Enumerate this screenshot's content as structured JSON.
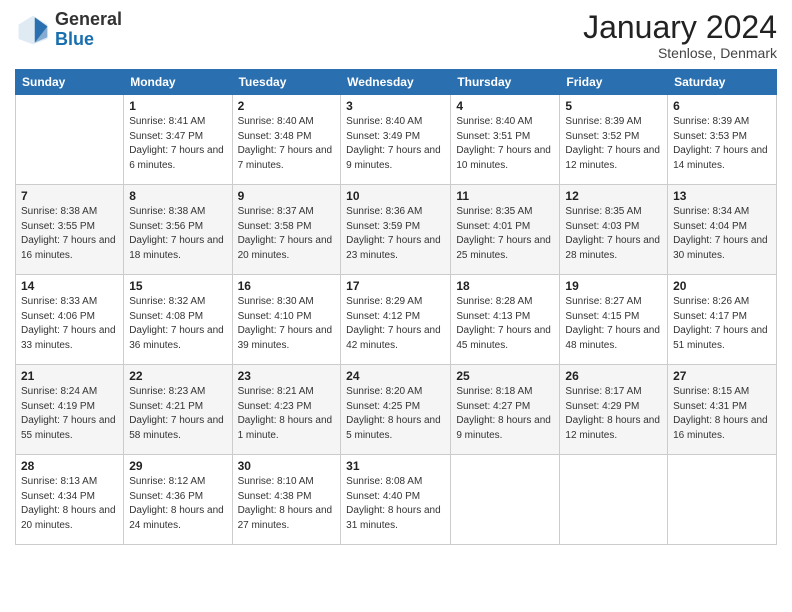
{
  "header": {
    "logo": {
      "general": "General",
      "blue": "Blue"
    },
    "title": "January 2024",
    "subtitle": "Stenlose, Denmark"
  },
  "days_of_week": [
    "Sunday",
    "Monday",
    "Tuesday",
    "Wednesday",
    "Thursday",
    "Friday",
    "Saturday"
  ],
  "weeks": [
    [
      {
        "num": "",
        "sunrise": "",
        "sunset": "",
        "daylight": ""
      },
      {
        "num": "1",
        "sunrise": "Sunrise: 8:41 AM",
        "sunset": "Sunset: 3:47 PM",
        "daylight": "Daylight: 7 hours and 6 minutes."
      },
      {
        "num": "2",
        "sunrise": "Sunrise: 8:40 AM",
        "sunset": "Sunset: 3:48 PM",
        "daylight": "Daylight: 7 hours and 7 minutes."
      },
      {
        "num": "3",
        "sunrise": "Sunrise: 8:40 AM",
        "sunset": "Sunset: 3:49 PM",
        "daylight": "Daylight: 7 hours and 9 minutes."
      },
      {
        "num": "4",
        "sunrise": "Sunrise: 8:40 AM",
        "sunset": "Sunset: 3:51 PM",
        "daylight": "Daylight: 7 hours and 10 minutes."
      },
      {
        "num": "5",
        "sunrise": "Sunrise: 8:39 AM",
        "sunset": "Sunset: 3:52 PM",
        "daylight": "Daylight: 7 hours and 12 minutes."
      },
      {
        "num": "6",
        "sunrise": "Sunrise: 8:39 AM",
        "sunset": "Sunset: 3:53 PM",
        "daylight": "Daylight: 7 hours and 14 minutes."
      }
    ],
    [
      {
        "num": "7",
        "sunrise": "Sunrise: 8:38 AM",
        "sunset": "Sunset: 3:55 PM",
        "daylight": "Daylight: 7 hours and 16 minutes."
      },
      {
        "num": "8",
        "sunrise": "Sunrise: 8:38 AM",
        "sunset": "Sunset: 3:56 PM",
        "daylight": "Daylight: 7 hours and 18 minutes."
      },
      {
        "num": "9",
        "sunrise": "Sunrise: 8:37 AM",
        "sunset": "Sunset: 3:58 PM",
        "daylight": "Daylight: 7 hours and 20 minutes."
      },
      {
        "num": "10",
        "sunrise": "Sunrise: 8:36 AM",
        "sunset": "Sunset: 3:59 PM",
        "daylight": "Daylight: 7 hours and 23 minutes."
      },
      {
        "num": "11",
        "sunrise": "Sunrise: 8:35 AM",
        "sunset": "Sunset: 4:01 PM",
        "daylight": "Daylight: 7 hours and 25 minutes."
      },
      {
        "num": "12",
        "sunrise": "Sunrise: 8:35 AM",
        "sunset": "Sunset: 4:03 PM",
        "daylight": "Daylight: 7 hours and 28 minutes."
      },
      {
        "num": "13",
        "sunrise": "Sunrise: 8:34 AM",
        "sunset": "Sunset: 4:04 PM",
        "daylight": "Daylight: 7 hours and 30 minutes."
      }
    ],
    [
      {
        "num": "14",
        "sunrise": "Sunrise: 8:33 AM",
        "sunset": "Sunset: 4:06 PM",
        "daylight": "Daylight: 7 hours and 33 minutes."
      },
      {
        "num": "15",
        "sunrise": "Sunrise: 8:32 AM",
        "sunset": "Sunset: 4:08 PM",
        "daylight": "Daylight: 7 hours and 36 minutes."
      },
      {
        "num": "16",
        "sunrise": "Sunrise: 8:30 AM",
        "sunset": "Sunset: 4:10 PM",
        "daylight": "Daylight: 7 hours and 39 minutes."
      },
      {
        "num": "17",
        "sunrise": "Sunrise: 8:29 AM",
        "sunset": "Sunset: 4:12 PM",
        "daylight": "Daylight: 7 hours and 42 minutes."
      },
      {
        "num": "18",
        "sunrise": "Sunrise: 8:28 AM",
        "sunset": "Sunset: 4:13 PM",
        "daylight": "Daylight: 7 hours and 45 minutes."
      },
      {
        "num": "19",
        "sunrise": "Sunrise: 8:27 AM",
        "sunset": "Sunset: 4:15 PM",
        "daylight": "Daylight: 7 hours and 48 minutes."
      },
      {
        "num": "20",
        "sunrise": "Sunrise: 8:26 AM",
        "sunset": "Sunset: 4:17 PM",
        "daylight": "Daylight: 7 hours and 51 minutes."
      }
    ],
    [
      {
        "num": "21",
        "sunrise": "Sunrise: 8:24 AM",
        "sunset": "Sunset: 4:19 PM",
        "daylight": "Daylight: 7 hours and 55 minutes."
      },
      {
        "num": "22",
        "sunrise": "Sunrise: 8:23 AM",
        "sunset": "Sunset: 4:21 PM",
        "daylight": "Daylight: 7 hours and 58 minutes."
      },
      {
        "num": "23",
        "sunrise": "Sunrise: 8:21 AM",
        "sunset": "Sunset: 4:23 PM",
        "daylight": "Daylight: 8 hours and 1 minute."
      },
      {
        "num": "24",
        "sunrise": "Sunrise: 8:20 AM",
        "sunset": "Sunset: 4:25 PM",
        "daylight": "Daylight: 8 hours and 5 minutes."
      },
      {
        "num": "25",
        "sunrise": "Sunrise: 8:18 AM",
        "sunset": "Sunset: 4:27 PM",
        "daylight": "Daylight: 8 hours and 9 minutes."
      },
      {
        "num": "26",
        "sunrise": "Sunrise: 8:17 AM",
        "sunset": "Sunset: 4:29 PM",
        "daylight": "Daylight: 8 hours and 12 minutes."
      },
      {
        "num": "27",
        "sunrise": "Sunrise: 8:15 AM",
        "sunset": "Sunset: 4:31 PM",
        "daylight": "Daylight: 8 hours and 16 minutes."
      }
    ],
    [
      {
        "num": "28",
        "sunrise": "Sunrise: 8:13 AM",
        "sunset": "Sunset: 4:34 PM",
        "daylight": "Daylight: 8 hours and 20 minutes."
      },
      {
        "num": "29",
        "sunrise": "Sunrise: 8:12 AM",
        "sunset": "Sunset: 4:36 PM",
        "daylight": "Daylight: 8 hours and 24 minutes."
      },
      {
        "num": "30",
        "sunrise": "Sunrise: 8:10 AM",
        "sunset": "Sunset: 4:38 PM",
        "daylight": "Daylight: 8 hours and 27 minutes."
      },
      {
        "num": "31",
        "sunrise": "Sunrise: 8:08 AM",
        "sunset": "Sunset: 4:40 PM",
        "daylight": "Daylight: 8 hours and 31 minutes."
      },
      {
        "num": "",
        "sunrise": "",
        "sunset": "",
        "daylight": ""
      },
      {
        "num": "",
        "sunrise": "",
        "sunset": "",
        "daylight": ""
      },
      {
        "num": "",
        "sunrise": "",
        "sunset": "",
        "daylight": ""
      }
    ]
  ]
}
